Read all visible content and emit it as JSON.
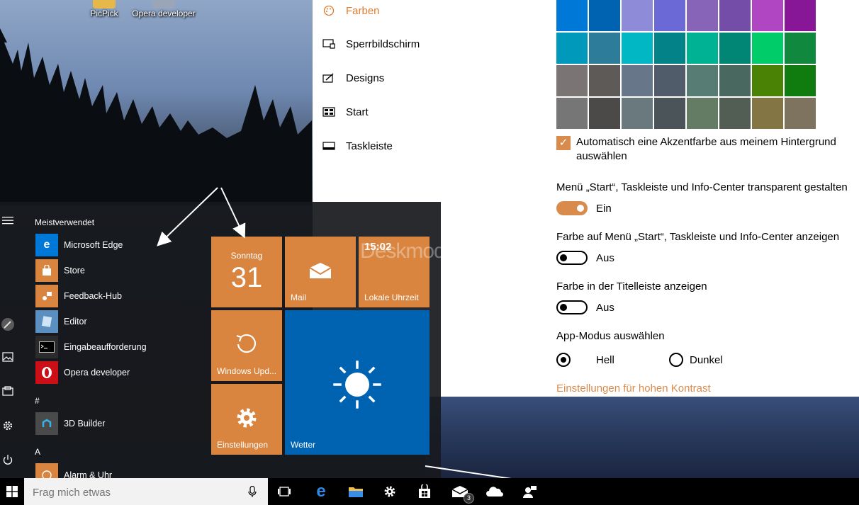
{
  "desktop": {
    "icons": [
      {
        "label": "PicPick"
      },
      {
        "label": "Opera developer"
      }
    ]
  },
  "settings": {
    "nav": [
      {
        "label": "Farben",
        "icon": "palette-icon",
        "active": true
      },
      {
        "label": "Sperrbildschirm",
        "icon": "lockscreen-icon"
      },
      {
        "label": "Designs",
        "icon": "designs-icon"
      },
      {
        "label": "Start",
        "icon": "start-icon"
      },
      {
        "label": "Taskleiste",
        "icon": "taskbar-icon"
      }
    ],
    "swatch_colors": [
      "#0078d7",
      "#0063b1",
      "#8e8cd8",
      "#6b69d6",
      "#8764b8",
      "#744da9",
      "#b146c2",
      "#881798",
      "#0099bc",
      "#2d7d9a",
      "#00b7c3",
      "#038387",
      "#00b294",
      "#018574",
      "#00cc6a",
      "#10893e",
      "#7a7574",
      "#5d5a58",
      "#68768a",
      "#515c6b",
      "#567c73",
      "#486860",
      "#498205",
      "#107c10",
      "#767676",
      "#4c4a48",
      "#69797e",
      "#4a5459",
      "#647c64",
      "#525e54",
      "#847545",
      "#7e735f"
    ],
    "auto_accent_label": "Automatisch eine Akzentfarbe aus meinem Hintergrund auswählen",
    "transparent": {
      "label": "Menü „Start“, Taskleiste und Info-Center transparent gestalten",
      "state": "Ein"
    },
    "color_start": {
      "label": "Farbe auf Menü „Start“, Taskleiste und Info-Center anzeigen",
      "state": "Aus"
    },
    "color_title": {
      "label": "Farbe in der Titelleiste anzeigen",
      "state": "Aus"
    },
    "app_mode": {
      "label": "App-Modus auswählen",
      "option_light": "Hell",
      "option_dark": "Dunkel",
      "selected": "Hell"
    },
    "high_contrast_link": "Einstellungen für hohen Kontrast",
    "accent_color": "#d98b4c"
  },
  "start_menu": {
    "most_used_header": "Meistverwendet",
    "most_used": [
      {
        "label": "Microsoft Edge"
      },
      {
        "label": "Store"
      },
      {
        "label": "Feedback-Hub"
      },
      {
        "label": "Editor"
      },
      {
        "label": "Eingabeaufforderung"
      },
      {
        "label": "Opera developer"
      }
    ],
    "hash_header": "#",
    "hash_apps": [
      {
        "label": "3D Builder"
      }
    ],
    "a_header": "A",
    "a_apps": [
      {
        "label": "Alarm & Uhr"
      }
    ],
    "tiles": {
      "calendar_day": "Sonntag",
      "calendar_date": "31",
      "mail": "Mail",
      "clock_time": "15:02",
      "clock_label": "Lokale Uhrzeit",
      "update": "Windows Upd...",
      "weather": "Wetter",
      "settings": "Einstellungen"
    },
    "tile_color": "#d9853f"
  },
  "taskbar": {
    "search_placeholder": "Frag mich etwas",
    "mail_badge": "3"
  },
  "watermark": "Deskmodder.de"
}
